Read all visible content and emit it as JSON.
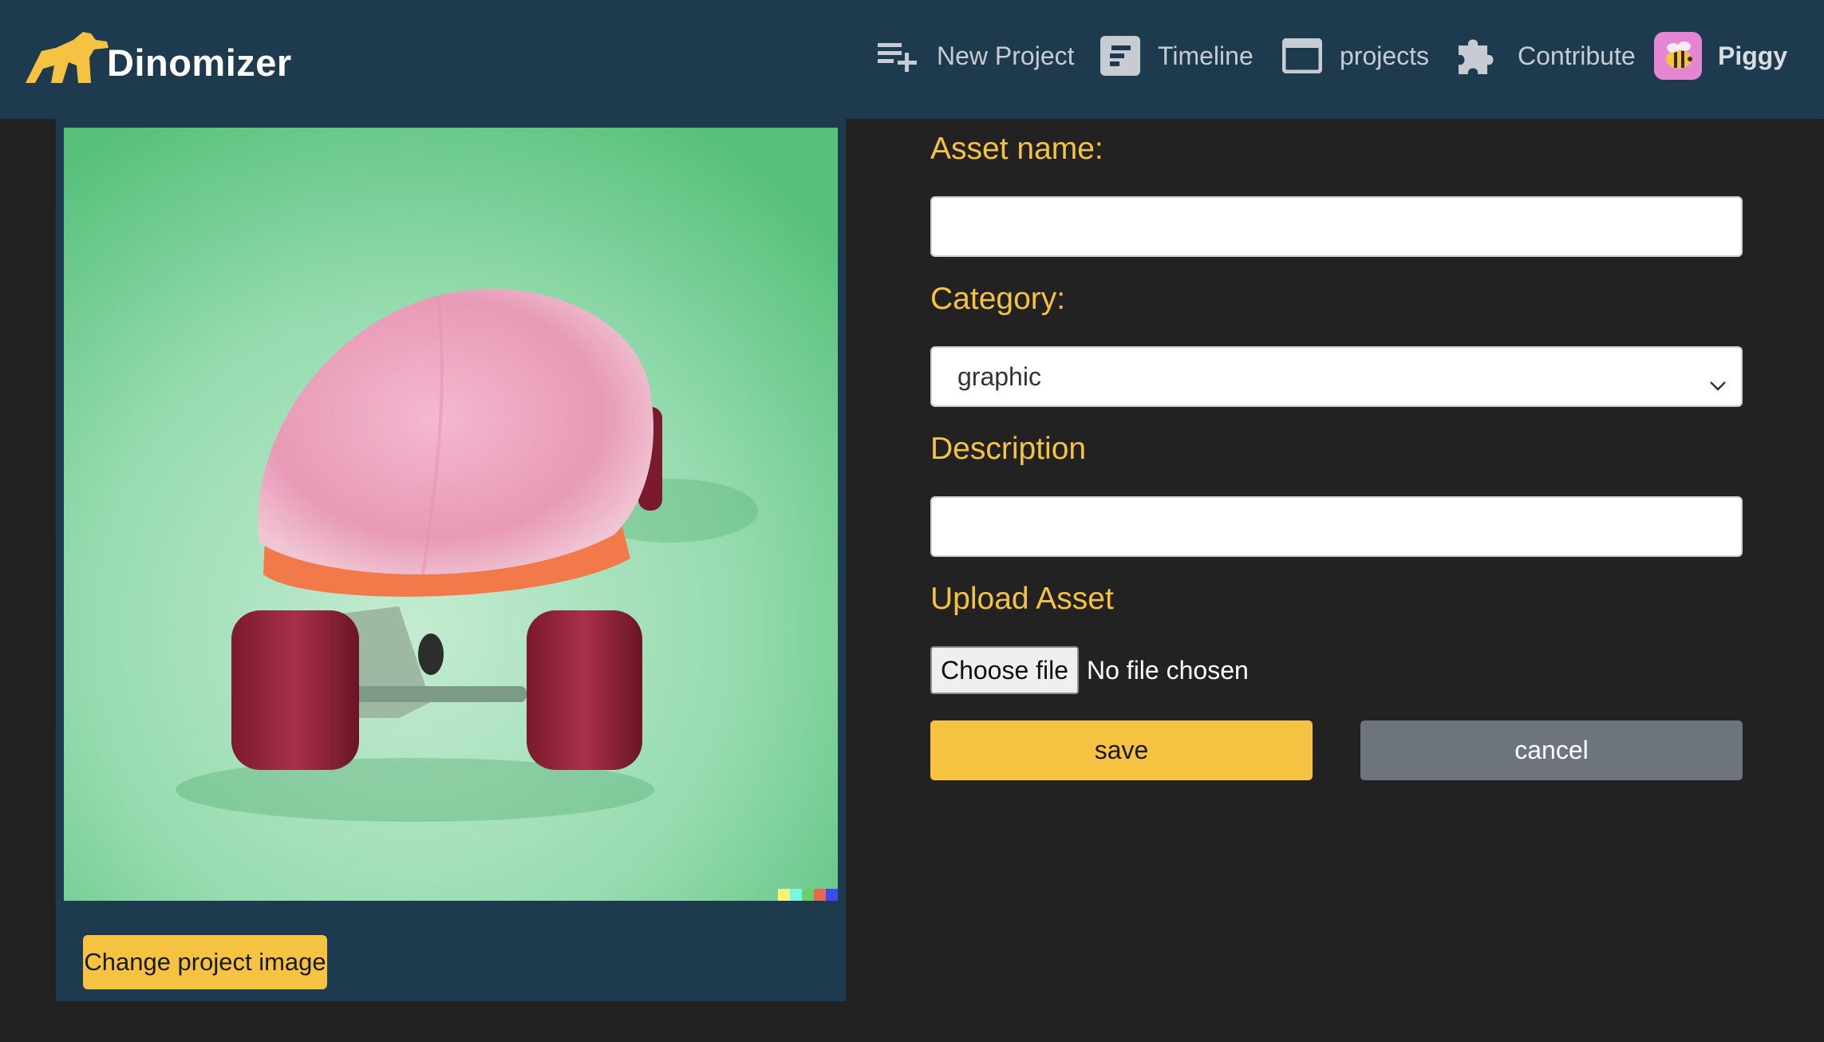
{
  "brand": {
    "name": "Dinomizer",
    "accent": "#f5c242",
    "navbar_bg": "#1d3a4f",
    "page_bg": "#222222"
  },
  "nav": {
    "items": [
      {
        "label": "New Project",
        "icon": "playlist-add-icon"
      },
      {
        "label": "Timeline",
        "icon": "timeline-icon"
      },
      {
        "label": "projects",
        "icon": "window-icon"
      },
      {
        "label": "Contribute",
        "icon": "puzzle-icon"
      }
    ],
    "user": {
      "name": "Piggy",
      "icon": "bee-avatar-icon"
    }
  },
  "left_panel": {
    "image_alt": "pink fluffy skateboard on green background",
    "change_image_label": "Change project image"
  },
  "form": {
    "asset_name_label": "Asset name:",
    "asset_name_value": "",
    "category_label": "Category:",
    "category_selected": "graphic",
    "description_label": "Description",
    "description_value": "",
    "upload_label": "Upload Asset",
    "choose_file_label": "Choose file",
    "no_file_text": "No file chosen",
    "save_label": "save",
    "cancel_label": "cancel"
  }
}
